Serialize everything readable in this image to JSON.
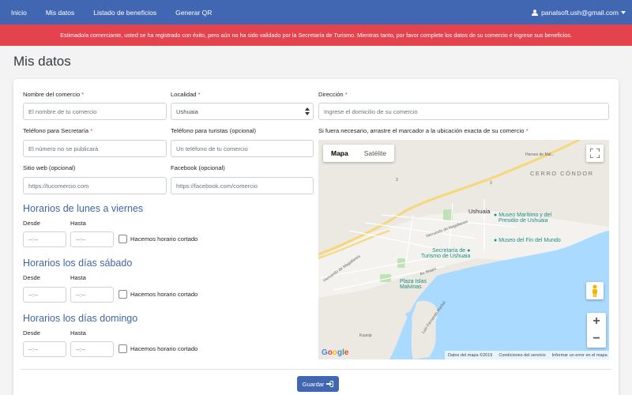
{
  "nav": {
    "items": [
      "Inicio",
      "Mis datos",
      "Listado de beneficios",
      "Generar QR"
    ],
    "user_email": "panalsoft.ush@gmail.com",
    "user_icon": "user-icon"
  },
  "alert": {
    "text": "Estimado/a comerciante, usted se ha registrado con éxito, pero aún no ha sido validado por la Secretaría de Turismo. Mientras tanto, por favor complete los datos de su comercio e ingrese sus beneficios."
  },
  "page": {
    "title": "Mis datos"
  },
  "form": {
    "nombre": {
      "label": "Nombre del comercio",
      "placeholder": "El nombre de tu comercio"
    },
    "localidad": {
      "label": "Localidad",
      "value": "Ushuaia"
    },
    "direccion": {
      "label": "Dirección",
      "placeholder": "Ingrese el domicilio de su comercio"
    },
    "tel_secretaria": {
      "label": "Teléfono para Secretaría",
      "placeholder": "El número no se publicará"
    },
    "tel_turistas": {
      "label": "Teléfono para turistas (opcional)",
      "placeholder": "Un teléfono de tu comercio"
    },
    "sitio_web": {
      "label": "Sitio web (opcional)",
      "placeholder": "https://tucomercio.com"
    },
    "facebook": {
      "label": "Facebook (opcional)",
      "placeholder": "https://facebook.com/comercio"
    },
    "map_label": "Si fuera necesario, arrastre el marcador a la ubicación exacta de su comercio",
    "required_mark": "*"
  },
  "schedules": [
    {
      "title": "Horarios de lunes a viernes",
      "desde": "Desde",
      "hasta": "Hasta",
      "desde_value": "--:--",
      "hasta_value": "--:--",
      "cortado": "Hacemos horario cortado"
    },
    {
      "title": "Horarios los días sábado",
      "desde": "Desde",
      "hasta": "Hasta",
      "desde_value": "--:--",
      "hasta_value": "--:--",
      "cortado": "Hacemos horario cortado"
    },
    {
      "title": "Horarios los días domingo",
      "desde": "Desde",
      "hasta": "Hasta",
      "desde_value": "--:--",
      "hasta_value": "--:--",
      "cortado": "Hacemos horario cortado"
    }
  ],
  "map": {
    "type_map": "Mapa",
    "type_sat": "Satélite",
    "labels": {
      "city": "Ushuaia",
      "area": "CERRO CÓNDOR",
      "poi1": "Museo Marítimo y del",
      "poi1b": "Presidio de Ushuaia",
      "poi2": "Museo del Fin del Mundo",
      "poi3": "Secretaría de",
      "poi3b": "Turismo de Ushuaia",
      "poi4": "Plaza Islas",
      "poi4b": "Malvinas",
      "road1": "Heroes de Mal...",
      "road2": "Hernando de Magallanes",
      "road3": "Hernando de Magallanes",
      "road4": "Av. Maipú",
      "road5": "Luis Fernando Martial",
      "road6": "Kuanip",
      "route3": "3",
      "route3b": "3"
    },
    "footer": {
      "data": "Datos del mapa ©2019",
      "terms": "Condiciones del servicio",
      "report": "Informar un error en el mapa"
    },
    "google": "Google",
    "zoom_in": "+",
    "zoom_out": "−"
  },
  "save_button": {
    "label": "Guardar"
  },
  "colors": {
    "navbar": "#4267b2",
    "alert": "#e4424d",
    "section_title": "#3d66a7",
    "water": "#aadaff",
    "poi": "#1a8f83"
  }
}
